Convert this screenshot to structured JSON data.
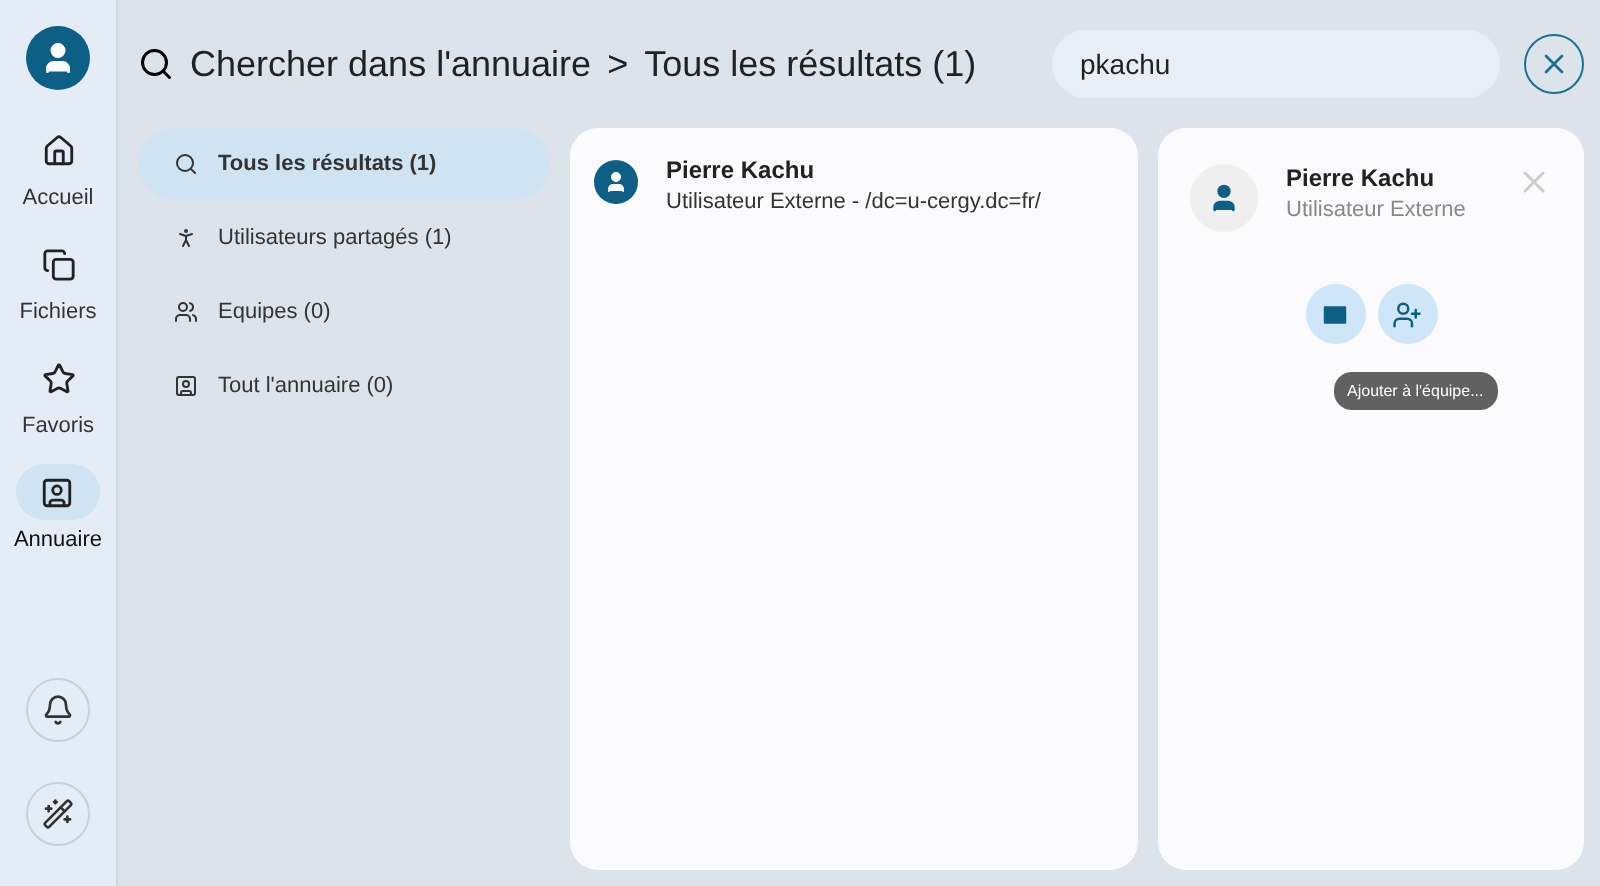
{
  "nav": {
    "items": [
      {
        "label": "Accueil",
        "selected": false
      },
      {
        "label": "Fichiers",
        "selected": false
      },
      {
        "label": "Favoris",
        "selected": false
      },
      {
        "label": "Annuaire",
        "selected": true
      }
    ]
  },
  "header": {
    "title": "Chercher dans l'annuaire",
    "separator": ">",
    "crumb": "Tous les résultats (1)",
    "search_value": "pkachu"
  },
  "filters": [
    {
      "label": "Tous les résultats (1)",
      "selected": true
    },
    {
      "label": "Utilisateurs partagés (1)",
      "selected": false
    },
    {
      "label": "Equipes (0)",
      "selected": false
    },
    {
      "label": "Tout l'annuaire (0)",
      "selected": false
    }
  ],
  "results": [
    {
      "name": "Pierre Kachu",
      "detail": "Utilisateur Externe - /dc=u-cergy.dc=fr/"
    }
  ],
  "detail": {
    "name": "Pierre Kachu",
    "role": "Utilisateur Externe",
    "tooltip": "Ajouter à l'équipe..."
  }
}
